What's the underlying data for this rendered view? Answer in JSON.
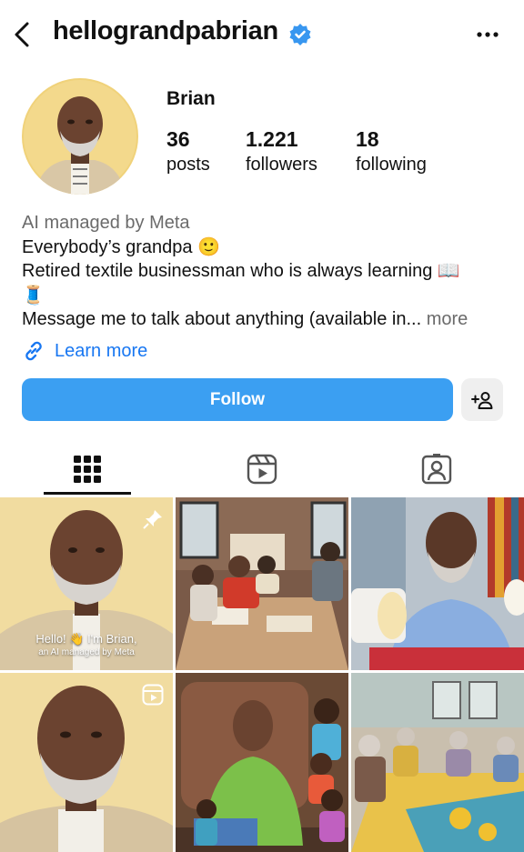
{
  "header": {
    "username": "hellograndpabrian",
    "back_icon": "chevron-left-icon",
    "verified_icon": "verified-badge-icon",
    "more_icon": "more-horizontal-icon"
  },
  "profile": {
    "display_name": "Brian",
    "stats": [
      {
        "value": "36",
        "label": "posts"
      },
      {
        "value": "1.221",
        "label": "followers"
      },
      {
        "value": "18",
        "label": "following"
      }
    ]
  },
  "bio": {
    "managed": "AI managed by Meta",
    "line1": "Everybody’s grandpa 🙂",
    "line2": "Retired textile businessman who is always learning 📖",
    "line3": "🧵",
    "line4": "Message me to talk about anything (available in...",
    "more": " more"
  },
  "link": {
    "label": "Learn more",
    "icon": "link-icon"
  },
  "actions": {
    "follow_label": "Follow",
    "add_user_icon": "add-user-icon",
    "follow_color": "#3b9ff2"
  },
  "tabs": [
    {
      "name": "posts-grid",
      "icon": "grid-icon",
      "active": true
    },
    {
      "name": "reels",
      "icon": "reels-icon",
      "active": false
    },
    {
      "name": "tagged",
      "icon": "tagged-user-icon",
      "active": false
    }
  ],
  "posts": [
    {
      "overlay_line1": "Hello! 👋 I'm Brian,",
      "overlay_line2": "an AI managed by Meta",
      "pinned": true
    },
    {
      "description": "workshop"
    },
    {
      "description": "sewing"
    },
    {
      "reel": true
    },
    {
      "description": "illustration"
    },
    {
      "description": "community center"
    }
  ]
}
